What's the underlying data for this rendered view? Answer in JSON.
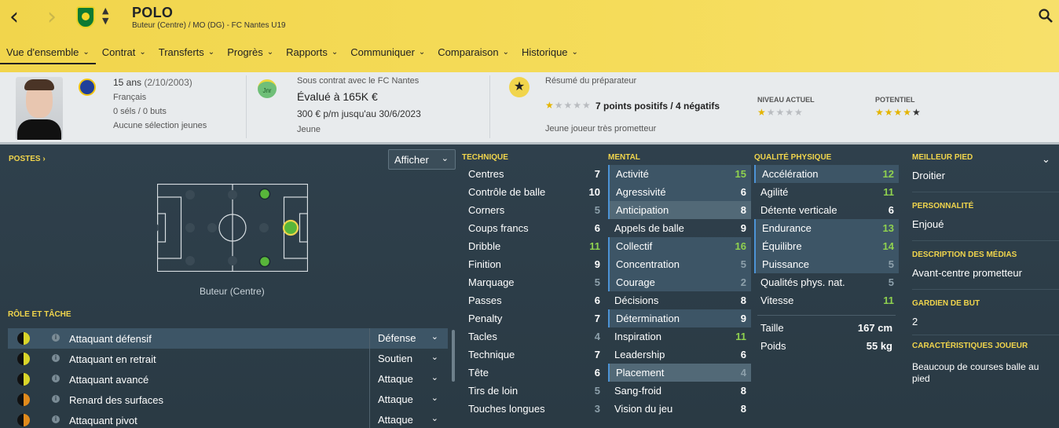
{
  "header": {
    "player_name": "POLO",
    "subtitle": "Buteur (Centre) / MO (DG) - FC Nantes U19",
    "colors": {
      "accent": "#f1d54c",
      "club_green": "#0d7a32"
    }
  },
  "menu": [
    {
      "label": "Vue d'ensemble"
    },
    {
      "label": "Contrat"
    },
    {
      "label": "Transferts"
    },
    {
      "label": "Progrès"
    },
    {
      "label": "Rapports"
    },
    {
      "label": "Communiquer"
    },
    {
      "label": "Comparaison"
    },
    {
      "label": "Historique"
    }
  ],
  "info": {
    "age": "15 ans",
    "dob": "(2/10/2003)",
    "nationality": "Français",
    "caps": "0 séls / 0 buts",
    "youth": "Aucune sélection jeunes",
    "contract_label": "Sous contrat avec le FC Nantes",
    "value": "Évalué à 165K €",
    "wage": "300 € p/m jusqu'au 30/6/2023",
    "status": "Jeune",
    "badge": "Jnr",
    "report_label": "Résumé du préparateur",
    "report_summary": "7 points positifs / 4 négatifs",
    "report_note": "Jeune joueur très prometteur",
    "current_label": "NIVEAU ACTUEL",
    "potential_label": "POTENTIEL",
    "report_stars": 1,
    "current_stars": 1,
    "potential_stars": 4
  },
  "positions": {
    "title": "POSTES",
    "dropdown": "Afficher",
    "position_label": "Buteur (Centre)"
  },
  "roles": {
    "title": "RÔLE ET TÂCHE",
    "items": [
      {
        "name": "Attaquant défensif",
        "duty": "Défense"
      },
      {
        "name": "Attaquant en retrait",
        "duty": "Soutien"
      },
      {
        "name": "Attaquant avancé",
        "duty": "Attaque"
      },
      {
        "name": "Renard des surfaces",
        "duty": "Attaque"
      },
      {
        "name": "Attaquant pivot",
        "duty": "Attaque"
      }
    ]
  },
  "technique": {
    "title": "TECHNIQUE",
    "items": [
      {
        "name": "Centres",
        "value": "7"
      },
      {
        "name": "Contrôle de balle",
        "value": "10"
      },
      {
        "name": "Corners",
        "value": "5"
      },
      {
        "name": "Coups francs",
        "value": "6"
      },
      {
        "name": "Dribble",
        "value": "11"
      },
      {
        "name": "Finition",
        "value": "9"
      },
      {
        "name": "Marquage",
        "value": "5"
      },
      {
        "name": "Passes",
        "value": "6"
      },
      {
        "name": "Penalty",
        "value": "7"
      },
      {
        "name": "Tacles",
        "value": "4"
      },
      {
        "name": "Technique",
        "value": "7"
      },
      {
        "name": "Tête",
        "value": "6"
      },
      {
        "name": "Tirs de loin",
        "value": "5"
      },
      {
        "name": "Touches longues",
        "value": "3"
      }
    ]
  },
  "mental": {
    "title": "MENTAL",
    "items": [
      {
        "name": "Activité",
        "value": "15"
      },
      {
        "name": "Agressivité",
        "value": "6"
      },
      {
        "name": "Anticipation",
        "value": "8"
      },
      {
        "name": "Appels de balle",
        "value": "9"
      },
      {
        "name": "Collectif",
        "value": "16"
      },
      {
        "name": "Concentration",
        "value": "5"
      },
      {
        "name": "Courage",
        "value": "2"
      },
      {
        "name": "Décisions",
        "value": "8"
      },
      {
        "name": "Détermination",
        "value": "9"
      },
      {
        "name": "Inspiration",
        "value": "11"
      },
      {
        "name": "Leadership",
        "value": "6"
      },
      {
        "name": "Placement",
        "value": "4"
      },
      {
        "name": "Sang-froid",
        "value": "8"
      },
      {
        "name": "Vision du jeu",
        "value": "8"
      }
    ]
  },
  "physical": {
    "title": "QUALITÉ PHYSIQUE",
    "items": [
      {
        "name": "Accélération",
        "value": "12"
      },
      {
        "name": "Agilité",
        "value": "11"
      },
      {
        "name": "Détente verticale",
        "value": "6"
      },
      {
        "name": "Endurance",
        "value": "13"
      },
      {
        "name": "Équilibre",
        "value": "14"
      },
      {
        "name": "Puissance",
        "value": "5"
      },
      {
        "name": "Qualités phys. nat.",
        "value": "5"
      },
      {
        "name": "Vitesse",
        "value": "11"
      }
    ],
    "height_label": "Taille",
    "height": "167 cm",
    "weight_label": "Poids",
    "weight": "55 kg"
  },
  "side": {
    "foot_label": "MEILLEUR PIED",
    "foot": "Droitier",
    "personality_label": "PERSONNALITÉ",
    "personality": "Enjoué",
    "media_label": "DESCRIPTION DES MÉDIAS",
    "media": "Avant-centre prometteur",
    "gk_label": "GARDIEN DE BUT",
    "gk": "2",
    "traits_label": "CARACTÉRISTIQUES JOUEUR",
    "traits": "Beaucoup de courses balle au pied"
  }
}
